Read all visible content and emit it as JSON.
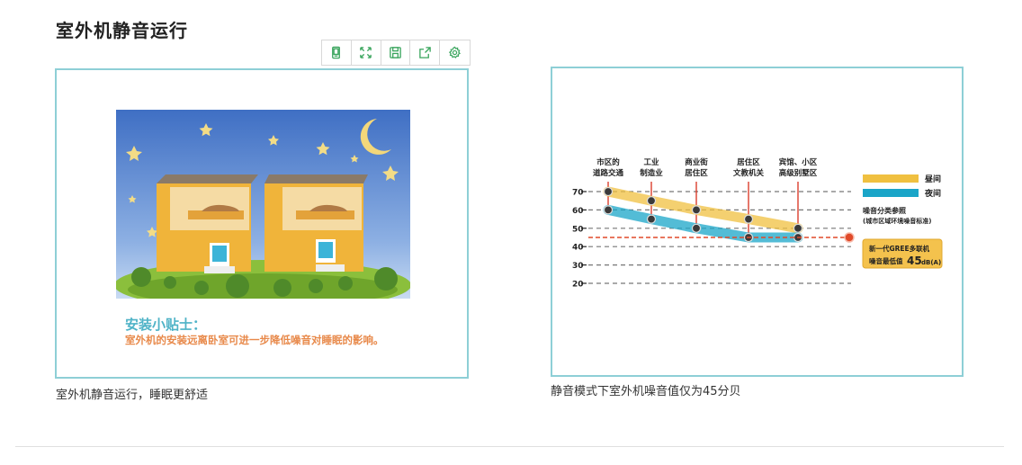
{
  "page": {
    "title": "室外机静音运行"
  },
  "toolbar": {
    "buttons": [
      {
        "name": "mobile-view",
        "icon": "tablet-icon"
      },
      {
        "name": "fullscreen",
        "icon": "expand-icon"
      },
      {
        "name": "save",
        "icon": "save-icon"
      },
      {
        "name": "share",
        "icon": "share-icon"
      },
      {
        "name": "settings",
        "icon": "gear-icon"
      }
    ],
    "icon_color": "#3aa55d"
  },
  "left_card": {
    "tip_title": "安装小贴士：",
    "tip_text": "室外机的安装远离卧室可进一步降低噪音对睡眠的影响。",
    "caption": "室外机静音运行，睡眠更舒适"
  },
  "right_card": {
    "caption": "静音模式下室外机噪音值仅为45分贝"
  },
  "chart_data": {
    "type": "line",
    "categories": [
      "市区的\n道路交通",
      "工业\n制造业",
      "商业街\n居住区",
      "居住区\n文教机关",
      "宾馆、小区\n高级别墅区"
    ],
    "category_lines": [
      [
        "市区的",
        "道路交通"
      ],
      [
        "工业",
        "制造业"
      ],
      [
        "商业街",
        "居住区"
      ],
      [
        "居住区",
        "文教机关"
      ],
      [
        "宾馆、小区",
        "高级别墅区"
      ]
    ],
    "y_ticks": [
      70,
      60,
      50,
      40,
      30,
      20
    ],
    "ylim": [
      20,
      70
    ],
    "series": [
      {
        "name": "昼间",
        "values": [
          70,
          65,
          60,
          55,
          50
        ],
        "color": "#f0c040"
      },
      {
        "name": "夜间",
        "values": [
          60,
          55,
          50,
          45,
          45
        ],
        "color": "#1aa5c8"
      }
    ],
    "reference_note": {
      "line1": "噪音分类参照",
      "line2": "(城市区域环境噪音标准)"
    },
    "threshold": {
      "value": 45,
      "label_line1": "新一代GREE多联机",
      "label_line2_prefix": "噪音最低值",
      "label_value": "45",
      "label_unit": "dB(A)",
      "color": "#e04a2a"
    }
  }
}
